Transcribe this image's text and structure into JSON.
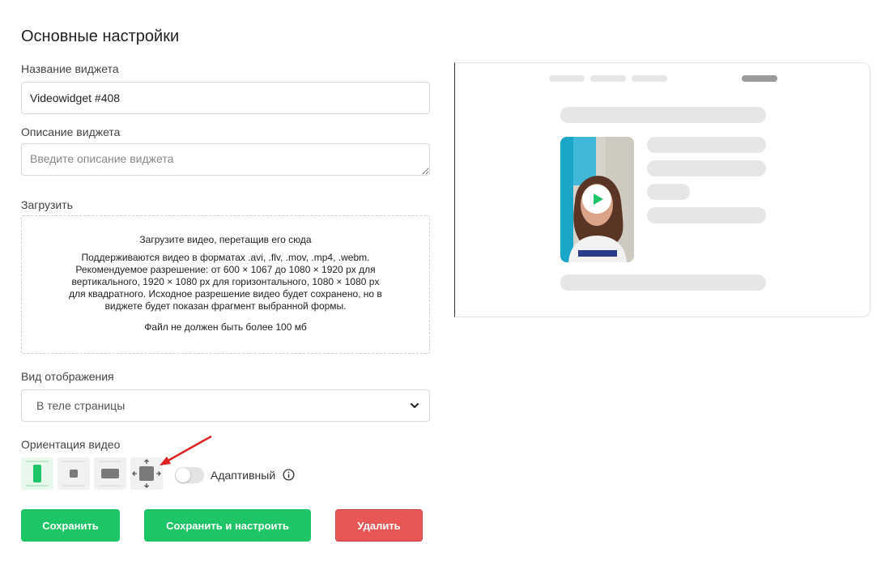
{
  "page_title": "Основные настройки",
  "widget_name": {
    "label": "Название виджета",
    "value": "Videowidget #408"
  },
  "widget_description": {
    "label": "Описание виджета",
    "placeholder": "Введите описание виджета"
  },
  "upload": {
    "label": "Загрузить",
    "title": "Загрузите видео, перетащив его сюда",
    "details": "Поддерживаются видео в форматах .avi, .flv, .mov, .mp4, .webm. Рекомендуемое разрешение: от 600 × 1067 до 1080 × 1920 px для вертикального, 1920 × 1080 px для горизонтального, 1080 × 1080 px для квадратного. Исходное разрешение видео будет сохранено, но в виджете будет показан фрагмент выбранной формы.",
    "size_limit": "Файл не должен быть более 100 мб"
  },
  "display_mode": {
    "label": "Вид отображения",
    "selected": "В теле страницы"
  },
  "orientation": {
    "label": "Ориентация видео",
    "options": [
      "vertical",
      "square",
      "horizontal",
      "free-resize"
    ],
    "selected": "vertical",
    "adaptive_label": "Адаптивный",
    "adaptive_enabled": false
  },
  "buttons": {
    "save": "Сохранить",
    "save_and_configure": "Сохранить и настроить",
    "delete": "Удалить"
  },
  "colors": {
    "primary_green": "#1dc567",
    "delete_red": "#e85656",
    "annotation_arrow": "#e02020"
  },
  "preview": {
    "play_icon": "play-icon"
  }
}
